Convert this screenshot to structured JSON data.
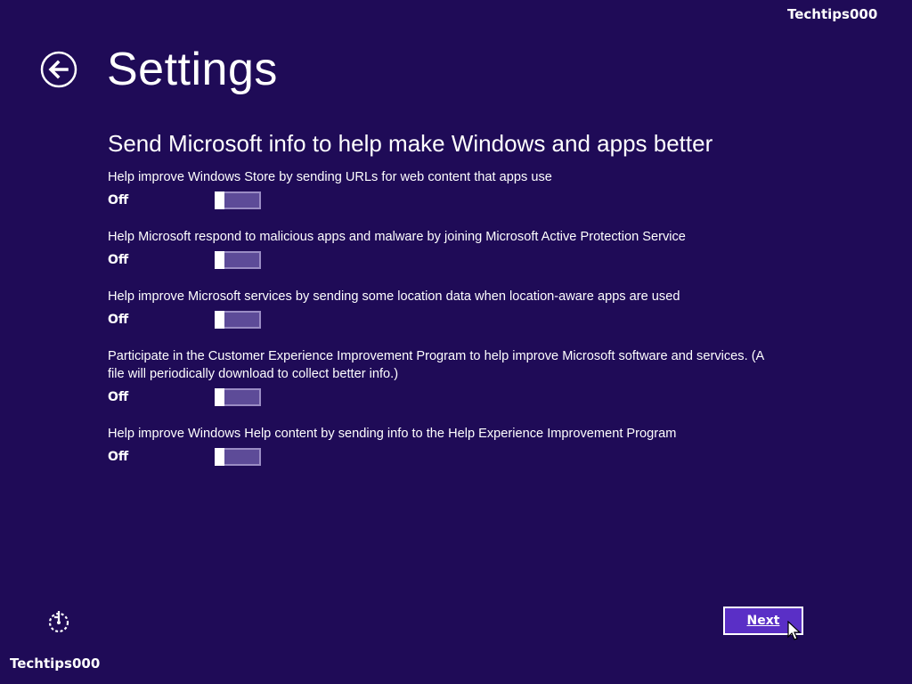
{
  "watermark": {
    "top": "Techtips000",
    "bottom": "Techtips000"
  },
  "header": {
    "title": "Settings",
    "back_icon": "back-arrow-circle-icon"
  },
  "section": {
    "title": "Send Microsoft info to help make Windows and apps better"
  },
  "settings": [
    {
      "description": "Help improve Windows Store by sending URLs for web content that apps use",
      "state": "Off"
    },
    {
      "description": "Help Microsoft respond to malicious apps and malware by joining Microsoft Active Protection Service",
      "state": "Off"
    },
    {
      "description": "Help improve Microsoft services by sending some location data when location-aware apps are used",
      "state": "Off"
    },
    {
      "description": "Participate in the Customer Experience Improvement Program to help improve Microsoft software and services. (A\nfile will periodically download to collect better info.)",
      "state": "Off"
    },
    {
      "description": "Help improve Windows Help content by sending info to the Help Experience Improvement Program",
      "state": "Off"
    }
  ],
  "footer": {
    "ease_of_access_icon": "ease-of-access-icon",
    "next_label": "Next"
  },
  "colors": {
    "background": "#1f0b57",
    "toggle_track": "#5d4b98",
    "next_button": "#5a2fc6"
  }
}
